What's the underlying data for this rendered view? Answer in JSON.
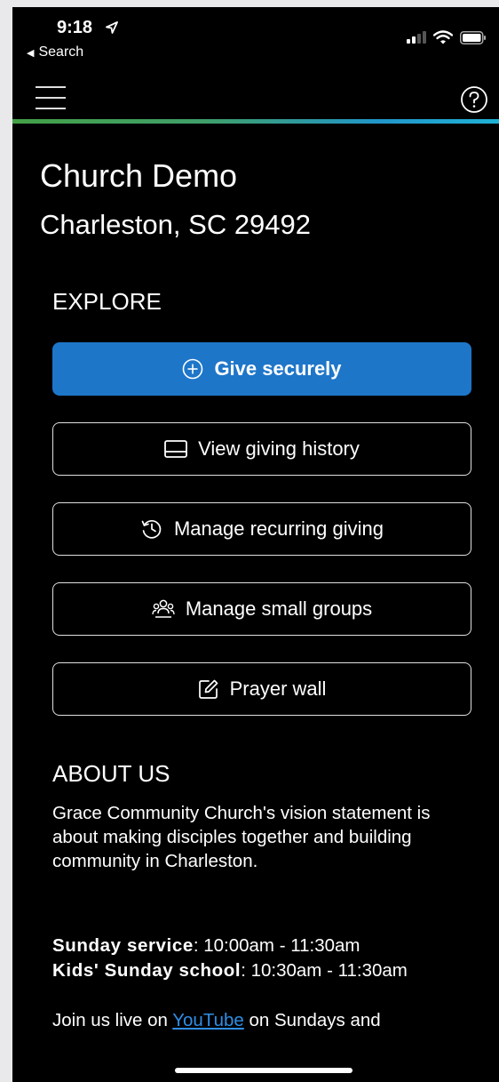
{
  "status_bar": {
    "time": "9:18",
    "back_label": "Search"
  },
  "app_bar": {
    "menu_icon": "hamburger-menu-icon",
    "help_icon": "help-circle-icon"
  },
  "church": {
    "name": "Church Demo",
    "address": "Charleston, SC 29492"
  },
  "explore": {
    "heading": "EXPLORE",
    "buttons": [
      {
        "label": "Give securely",
        "icon": "plus-circle-icon"
      },
      {
        "label": "View giving history",
        "icon": "history-panel-icon"
      },
      {
        "label": "Manage recurring giving",
        "icon": "recurring-clock-icon"
      },
      {
        "label": "Manage small groups",
        "icon": "group-people-icon"
      },
      {
        "label": "Prayer wall",
        "icon": "edit-note-icon"
      }
    ]
  },
  "about": {
    "heading": "ABOUT US",
    "text": "Grace Community Church's vision statement is about making disciples together and building community in Charleston.",
    "service_label": "Sunday service",
    "service_time": ": 10:00am - 11:30am",
    "kids_label": "Kids' Sunday school",
    "kids_time": ": 10:30am - 11:30am",
    "youtube_prefix": "Join us live on ",
    "youtube_link": "YouTube",
    "youtube_suffix": " on Sundays and"
  },
  "colors": {
    "primary_button": "#1e76c9",
    "link": "#2f8ee6",
    "background": "#000000"
  }
}
